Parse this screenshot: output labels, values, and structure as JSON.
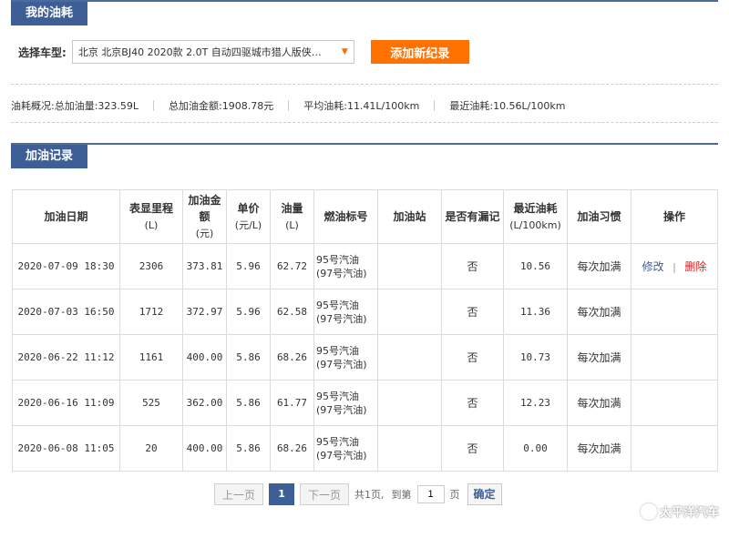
{
  "section1": {
    "title": "我的油耗"
  },
  "car_select": {
    "label": "选择车型:",
    "value": "北京 北京BJ40 2020款 2.0T 自动四驱城市猎人版侠…",
    "arrow": "▼"
  },
  "add_button": "添加新纪录",
  "summary": [
    "油耗概况:总加油量:323.59L",
    "总加油金额:1908.78元",
    "平均油耗:11.41L/100km",
    "最近油耗:10.56L/100km"
  ],
  "section2": {
    "title": "加油记录"
  },
  "table": {
    "headers": [
      {
        "label": "加油日期",
        "unit": ""
      },
      {
        "label": "表显里程",
        "unit": "(L)"
      },
      {
        "label": "加油金额",
        "unit": "(元)"
      },
      {
        "label": "单价",
        "unit": "(元/L)"
      },
      {
        "label": "油量",
        "unit": "(L)"
      },
      {
        "label": "燃油标号",
        "unit": ""
      },
      {
        "label": "加油站",
        "unit": ""
      },
      {
        "label": "是否有漏记",
        "unit": ""
      },
      {
        "label": "最近油耗",
        "unit": "(L/100km)"
      },
      {
        "label": "加油习惯",
        "unit": ""
      },
      {
        "label": "操作",
        "unit": ""
      }
    ],
    "rows": [
      {
        "date": "2020-07-09 18:30",
        "mileage": "2306",
        "amount": "373.81",
        "price": "5.96",
        "volume": "62.72",
        "fuel": "95号汽油 (97号汽油)",
        "station": "",
        "missed": "否",
        "consumption": "10.56",
        "habit": "每次加满",
        "edit": "修改",
        "sep": "|",
        "delete": "删除"
      },
      {
        "date": "2020-07-03 16:50",
        "mileage": "1712",
        "amount": "372.97",
        "price": "5.96",
        "volume": "62.58",
        "fuel": "95号汽油 (97号汽油)",
        "station": "",
        "missed": "否",
        "consumption": "11.36",
        "habit": "每次加满"
      },
      {
        "date": "2020-06-22 11:12",
        "mileage": "1161",
        "amount": "400.00",
        "price": "5.86",
        "volume": "68.26",
        "fuel": "95号汽油 (97号汽油)",
        "station": "",
        "missed": "否",
        "consumption": "10.73",
        "habit": "每次加满"
      },
      {
        "date": "2020-06-16 11:09",
        "mileage": "525",
        "amount": "362.00",
        "price": "5.86",
        "volume": "61.77",
        "fuel": "95号汽油 (97号汽油)",
        "station": "",
        "missed": "否",
        "consumption": "12.23",
        "habit": "每次加满"
      },
      {
        "date": "2020-06-08 11:05",
        "mileage": "20",
        "amount": "400.00",
        "price": "5.86",
        "volume": "68.26",
        "fuel": "95号汽油 (97号汽油)",
        "station": "",
        "missed": "否",
        "consumption": "0.00",
        "habit": "每次加满"
      }
    ]
  },
  "pager": {
    "prev": "上一页",
    "current": "1",
    "next": "下一页",
    "total": "共1页,",
    "goto": "到第",
    "goto_value": "1",
    "page_suffix": "页",
    "confirm": "确定"
  },
  "watermark": "太平洋汽车",
  "colors": {
    "header_blue": "#3e5f96",
    "accent_orange": "#ff7200",
    "delete_red": "#d42020"
  }
}
